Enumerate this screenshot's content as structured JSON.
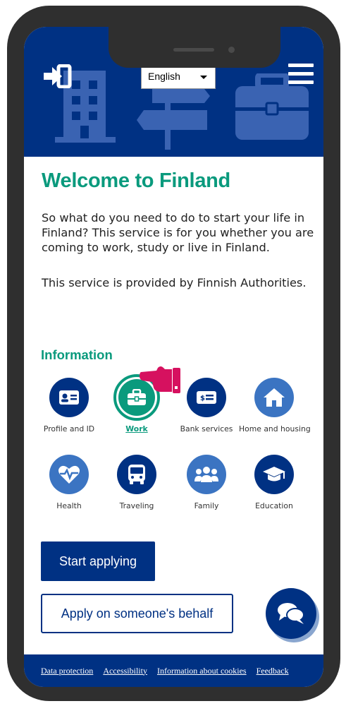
{
  "header": {
    "language": {
      "selected": "English"
    }
  },
  "main": {
    "title": "Welcome to Finland",
    "intro": "So what do you need to do to start your life in Finland? This service is for you whether you are coming to work, study or live in Finland.",
    "provided_by": "This service is provided by Finnish Authorities.",
    "info_heading": "Information",
    "tiles": [
      {
        "label": "Profile and ID",
        "icon": "id-card-icon",
        "active": false
      },
      {
        "label": "Work",
        "icon": "briefcase-icon",
        "active": true
      },
      {
        "label": "Bank services",
        "icon": "banknote-icon",
        "active": false
      },
      {
        "label": "Home and housing",
        "icon": "house-icon",
        "active": false
      },
      {
        "label": "Health",
        "icon": "heart-pulse-icon",
        "active": false
      },
      {
        "label": "Traveling",
        "icon": "bus-icon",
        "active": false
      },
      {
        "label": "Family",
        "icon": "people-icon",
        "active": false
      },
      {
        "label": "Education",
        "icon": "graduation-cap-icon",
        "active": false
      }
    ],
    "start_label": "Start applying",
    "behalf_label": "Apply on someone's behalf"
  },
  "footer": {
    "links": [
      "Data protection",
      "Accessibility",
      "Information about cookies",
      "Feedback"
    ]
  },
  "colors": {
    "brand_blue": "#003183",
    "accent_green": "#0a9a7d",
    "icon_light_blue": "#3b74c2",
    "pointer_pink": "#d6115f"
  }
}
